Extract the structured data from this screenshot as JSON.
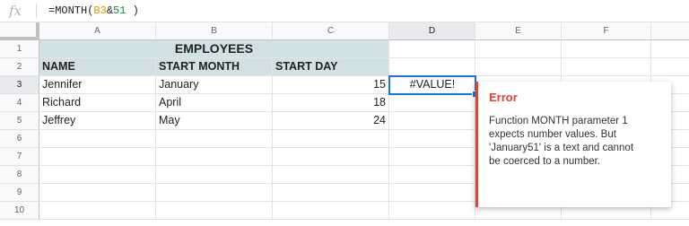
{
  "formula_bar": {
    "fx_label": "fx",
    "formula_prefix": "=MONTH(",
    "formula_ref": "B3",
    "formula_op": "&",
    "formula_num": "51",
    "formula_suffix": " )"
  },
  "columns": [
    "A",
    "B",
    "C",
    "D",
    "E",
    "F"
  ],
  "rows": [
    "1",
    "2",
    "3",
    "4",
    "5",
    "6",
    "7",
    "8",
    "9",
    "10"
  ],
  "sheet": {
    "title": "EMPLOYEES",
    "headers": [
      "NAME",
      "START MONTH",
      "START DAY"
    ],
    "records": [
      {
        "name": "Jennifer",
        "month": "January",
        "day": "15"
      },
      {
        "name": "Richard",
        "month": "April",
        "day": "18"
      },
      {
        "name": "Jeffrey",
        "month": "May",
        "day": "24"
      }
    ],
    "d3_value": "#VALUE!"
  },
  "error_popup": {
    "title": "Error",
    "lines": [
      "Function MONTH parameter 1",
      "expects number values. But",
      "'January51' is a text and cannot",
      "be coerced to a number."
    ]
  },
  "colors": {
    "header_fill": "#d0e0e3",
    "selection": "#1a73e8",
    "error": "#db4437",
    "formula_ref": "#e09a00",
    "formula_number": "#0f8f4e"
  }
}
